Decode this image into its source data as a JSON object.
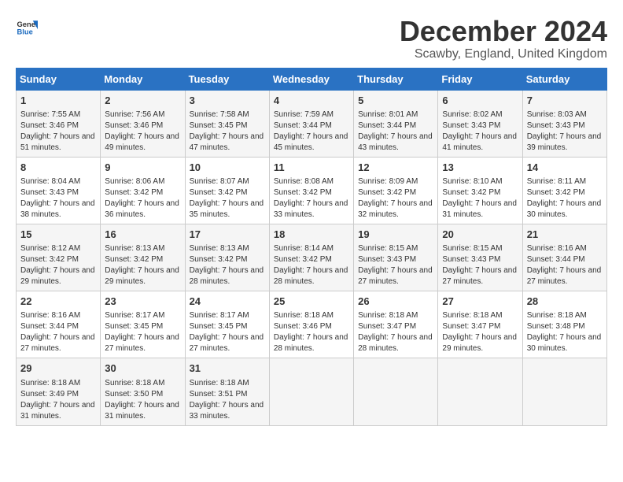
{
  "logo": {
    "line1": "General",
    "line2": "Blue"
  },
  "title": "December 2024",
  "subtitle": "Scawby, England, United Kingdom",
  "days_header": [
    "Sunday",
    "Monday",
    "Tuesday",
    "Wednesday",
    "Thursday",
    "Friday",
    "Saturday"
  ],
  "weeks": [
    [
      {
        "day": "1",
        "sunrise": "Sunrise: 7:55 AM",
        "sunset": "Sunset: 3:46 PM",
        "daylight": "Daylight: 7 hours and 51 minutes."
      },
      {
        "day": "2",
        "sunrise": "Sunrise: 7:56 AM",
        "sunset": "Sunset: 3:46 PM",
        "daylight": "Daylight: 7 hours and 49 minutes."
      },
      {
        "day": "3",
        "sunrise": "Sunrise: 7:58 AM",
        "sunset": "Sunset: 3:45 PM",
        "daylight": "Daylight: 7 hours and 47 minutes."
      },
      {
        "day": "4",
        "sunrise": "Sunrise: 7:59 AM",
        "sunset": "Sunset: 3:44 PM",
        "daylight": "Daylight: 7 hours and 45 minutes."
      },
      {
        "day": "5",
        "sunrise": "Sunrise: 8:01 AM",
        "sunset": "Sunset: 3:44 PM",
        "daylight": "Daylight: 7 hours and 43 minutes."
      },
      {
        "day": "6",
        "sunrise": "Sunrise: 8:02 AM",
        "sunset": "Sunset: 3:43 PM",
        "daylight": "Daylight: 7 hours and 41 minutes."
      },
      {
        "day": "7",
        "sunrise": "Sunrise: 8:03 AM",
        "sunset": "Sunset: 3:43 PM",
        "daylight": "Daylight: 7 hours and 39 minutes."
      }
    ],
    [
      {
        "day": "8",
        "sunrise": "Sunrise: 8:04 AM",
        "sunset": "Sunset: 3:43 PM",
        "daylight": "Daylight: 7 hours and 38 minutes."
      },
      {
        "day": "9",
        "sunrise": "Sunrise: 8:06 AM",
        "sunset": "Sunset: 3:42 PM",
        "daylight": "Daylight: 7 hours and 36 minutes."
      },
      {
        "day": "10",
        "sunrise": "Sunrise: 8:07 AM",
        "sunset": "Sunset: 3:42 PM",
        "daylight": "Daylight: 7 hours and 35 minutes."
      },
      {
        "day": "11",
        "sunrise": "Sunrise: 8:08 AM",
        "sunset": "Sunset: 3:42 PM",
        "daylight": "Daylight: 7 hours and 33 minutes."
      },
      {
        "day": "12",
        "sunrise": "Sunrise: 8:09 AM",
        "sunset": "Sunset: 3:42 PM",
        "daylight": "Daylight: 7 hours and 32 minutes."
      },
      {
        "day": "13",
        "sunrise": "Sunrise: 8:10 AM",
        "sunset": "Sunset: 3:42 PM",
        "daylight": "Daylight: 7 hours and 31 minutes."
      },
      {
        "day": "14",
        "sunrise": "Sunrise: 8:11 AM",
        "sunset": "Sunset: 3:42 PM",
        "daylight": "Daylight: 7 hours and 30 minutes."
      }
    ],
    [
      {
        "day": "15",
        "sunrise": "Sunrise: 8:12 AM",
        "sunset": "Sunset: 3:42 PM",
        "daylight": "Daylight: 7 hours and 29 minutes."
      },
      {
        "day": "16",
        "sunrise": "Sunrise: 8:13 AM",
        "sunset": "Sunset: 3:42 PM",
        "daylight": "Daylight: 7 hours and 29 minutes."
      },
      {
        "day": "17",
        "sunrise": "Sunrise: 8:13 AM",
        "sunset": "Sunset: 3:42 PM",
        "daylight": "Daylight: 7 hours and 28 minutes."
      },
      {
        "day": "18",
        "sunrise": "Sunrise: 8:14 AM",
        "sunset": "Sunset: 3:42 PM",
        "daylight": "Daylight: 7 hours and 28 minutes."
      },
      {
        "day": "19",
        "sunrise": "Sunrise: 8:15 AM",
        "sunset": "Sunset: 3:43 PM",
        "daylight": "Daylight: 7 hours and 27 minutes."
      },
      {
        "day": "20",
        "sunrise": "Sunrise: 8:15 AM",
        "sunset": "Sunset: 3:43 PM",
        "daylight": "Daylight: 7 hours and 27 minutes."
      },
      {
        "day": "21",
        "sunrise": "Sunrise: 8:16 AM",
        "sunset": "Sunset: 3:44 PM",
        "daylight": "Daylight: 7 hours and 27 minutes."
      }
    ],
    [
      {
        "day": "22",
        "sunrise": "Sunrise: 8:16 AM",
        "sunset": "Sunset: 3:44 PM",
        "daylight": "Daylight: 7 hours and 27 minutes."
      },
      {
        "day": "23",
        "sunrise": "Sunrise: 8:17 AM",
        "sunset": "Sunset: 3:45 PM",
        "daylight": "Daylight: 7 hours and 27 minutes."
      },
      {
        "day": "24",
        "sunrise": "Sunrise: 8:17 AM",
        "sunset": "Sunset: 3:45 PM",
        "daylight": "Daylight: 7 hours and 27 minutes."
      },
      {
        "day": "25",
        "sunrise": "Sunrise: 8:18 AM",
        "sunset": "Sunset: 3:46 PM",
        "daylight": "Daylight: 7 hours and 28 minutes."
      },
      {
        "day": "26",
        "sunrise": "Sunrise: 8:18 AM",
        "sunset": "Sunset: 3:47 PM",
        "daylight": "Daylight: 7 hours and 28 minutes."
      },
      {
        "day": "27",
        "sunrise": "Sunrise: 8:18 AM",
        "sunset": "Sunset: 3:47 PM",
        "daylight": "Daylight: 7 hours and 29 minutes."
      },
      {
        "day": "28",
        "sunrise": "Sunrise: 8:18 AM",
        "sunset": "Sunset: 3:48 PM",
        "daylight": "Daylight: 7 hours and 30 minutes."
      }
    ],
    [
      {
        "day": "29",
        "sunrise": "Sunrise: 8:18 AM",
        "sunset": "Sunset: 3:49 PM",
        "daylight": "Daylight: 7 hours and 31 minutes."
      },
      {
        "day": "30",
        "sunrise": "Sunrise: 8:18 AM",
        "sunset": "Sunset: 3:50 PM",
        "daylight": "Daylight: 7 hours and 31 minutes."
      },
      {
        "day": "31",
        "sunrise": "Sunrise: 8:18 AM",
        "sunset": "Sunset: 3:51 PM",
        "daylight": "Daylight: 7 hours and 33 minutes."
      },
      null,
      null,
      null,
      null
    ]
  ]
}
